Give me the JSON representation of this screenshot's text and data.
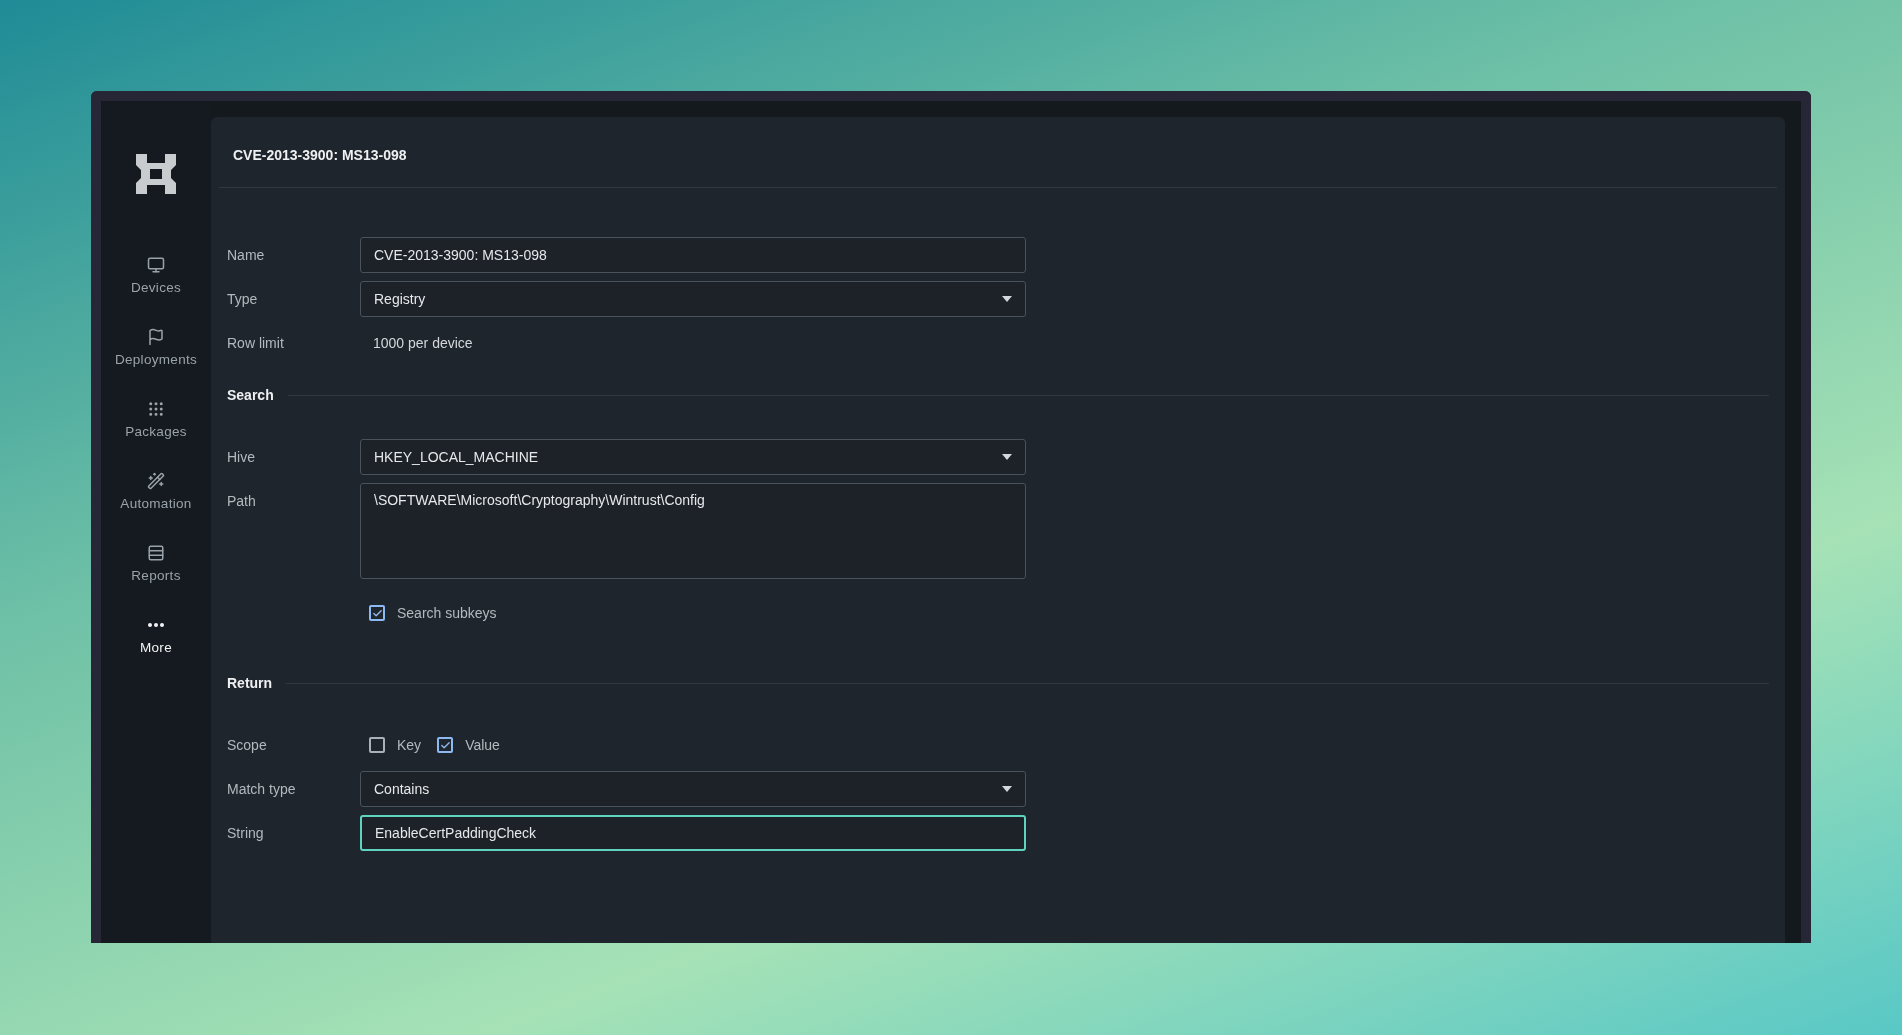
{
  "sidebar": {
    "items": [
      {
        "label": "Devices",
        "selected": false
      },
      {
        "label": "Deployments",
        "selected": false
      },
      {
        "label": "Packages",
        "selected": false
      },
      {
        "label": "Automation",
        "selected": false
      },
      {
        "label": "Reports",
        "selected": false
      },
      {
        "label": "More",
        "selected": true
      }
    ]
  },
  "title": "CVE-2013-3900: MS13-098",
  "fields": [
    {
      "kind": "input",
      "label": "Name",
      "value": "CVE-2013-3900: MS13-098",
      "focused": false
    },
    {
      "kind": "select",
      "label": "Type",
      "value": "Registry"
    },
    {
      "kind": "text",
      "label": "Row limit",
      "value": "1000 per device"
    }
  ],
  "sections": [
    {
      "heading": "Search",
      "fields": [
        {
          "kind": "select",
          "label": "Hive",
          "value": "HKEY_LOCAL_MACHINE"
        },
        {
          "kind": "textarea",
          "label": "Path",
          "value": "\\SOFTWARE\\Microsoft\\Cryptography\\Wintrust\\Config"
        },
        {
          "kind": "checkboxes",
          "options": [
            {
              "label": "Search subkeys",
              "checked": true
            }
          ]
        }
      ]
    },
    {
      "heading": "Return",
      "fields": [
        {
          "kind": "checkboxes",
          "label": "Scope",
          "options": [
            {
              "label": "Key",
              "checked": false
            },
            {
              "label": "Value",
              "checked": true
            }
          ]
        },
        {
          "kind": "select",
          "label": "Match type",
          "value": "Contains"
        },
        {
          "kind": "input",
          "label": "String",
          "value": "EnableCertPaddingCheck",
          "focused": true
        }
      ]
    }
  ]
}
